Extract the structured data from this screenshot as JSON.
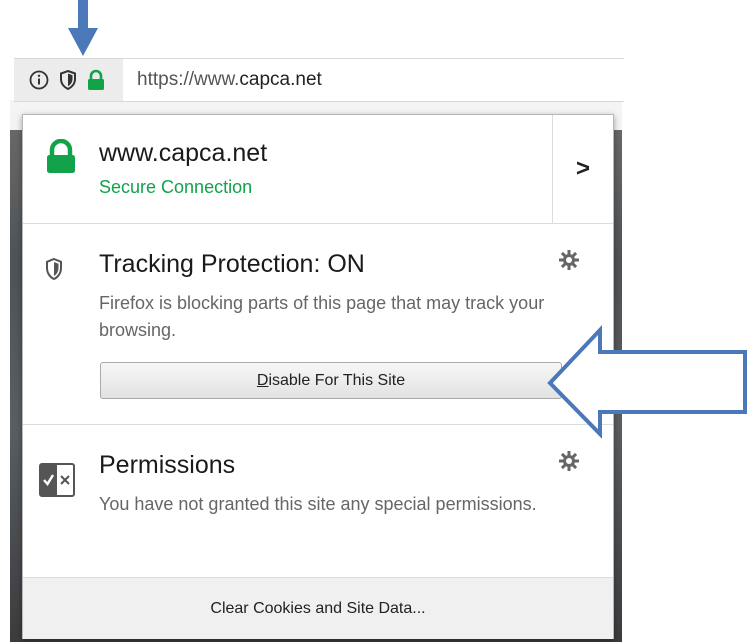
{
  "urlbar": {
    "url_prefix": "https://www.",
    "url_domain": "capca.net"
  },
  "identity": {
    "host": "www.capca.net",
    "status": "Secure Connection",
    "more_label": ">"
  },
  "tracking": {
    "title": "Tracking Protection: ON",
    "description": "Firefox is blocking parts of this page that may track your browsing.",
    "button_label_underlined": "D",
    "button_label_rest": "isable For This Site"
  },
  "permissions": {
    "title": "Permissions",
    "description": "You have not granted this site any special permissions."
  },
  "footer": {
    "clear_label": "Clear Cookies and Site Data..."
  },
  "colors": {
    "secure_green": "#12a24a",
    "annotation_arrow": "#4a78b8"
  },
  "icons": [
    "info-icon",
    "shield-icon",
    "lock-icon",
    "gear-icon",
    "permissions-icon",
    "chevron-right-icon"
  ]
}
